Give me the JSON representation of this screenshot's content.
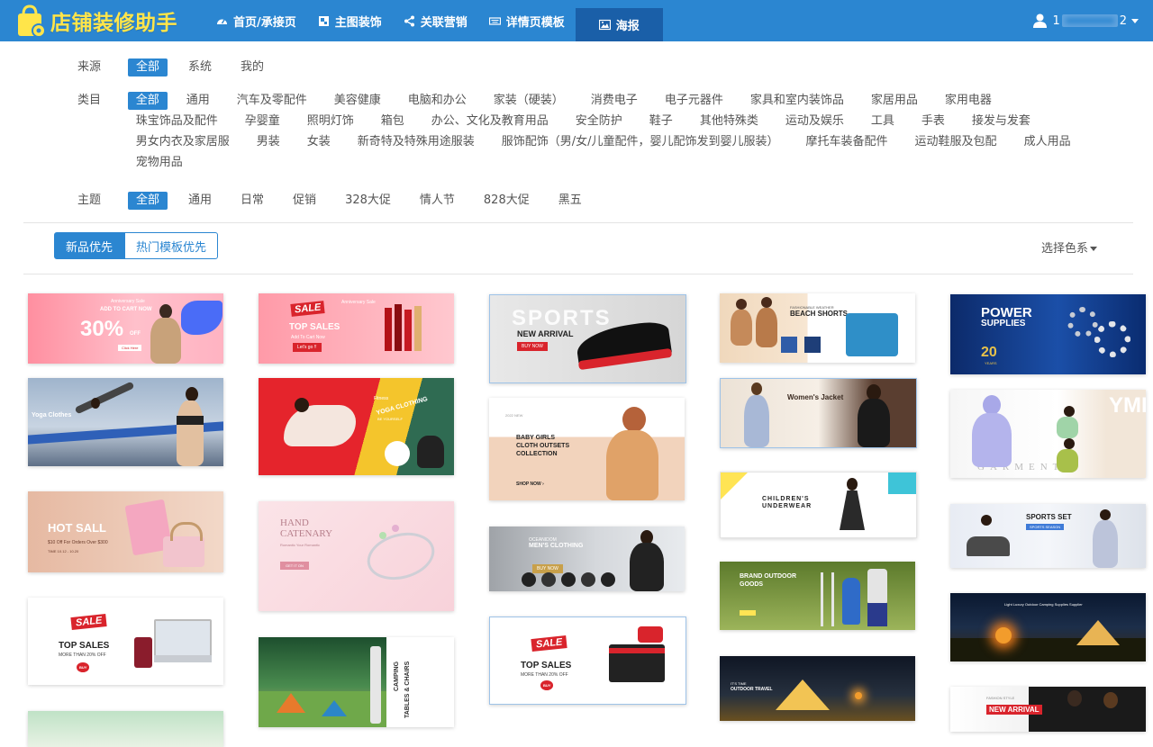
{
  "app": {
    "title": "店铺装修助手"
  },
  "nav": {
    "items": [
      {
        "label": "首页/承接页",
        "icon": "dashboard-icon"
      },
      {
        "label": "主图装饰",
        "icon": "image-frame-icon"
      },
      {
        "label": "关联营销",
        "icon": "share-icon"
      },
      {
        "label": "详情页模板",
        "icon": "keyboard-icon"
      },
      {
        "label": "海报",
        "icon": "picture-icon",
        "active": true
      }
    ],
    "user_prefix": "1",
    "user_suffix": "2"
  },
  "filters": {
    "source": {
      "label": "来源",
      "options": [
        "全部",
        "系统",
        "我的"
      ],
      "selected": "全部"
    },
    "category": {
      "label": "类目",
      "options": [
        "全部",
        "通用",
        "汽车及零配件",
        "美容健康",
        "电脑和办公",
        "家装（硬装）",
        "消费电子",
        "电子元器件",
        "家具和室内装饰品",
        "家居用品",
        "家用电器",
        "珠宝饰品及配件",
        "孕婴童",
        "照明灯饰",
        "箱包",
        "办公、文化及教育用品",
        "安全防护",
        "鞋子",
        "其他特殊类",
        "运动及娱乐",
        "工具",
        "手表",
        "接发与发套",
        "男女内衣及家居服",
        "男装",
        "女装",
        "新奇特及特殊用途服装",
        "服饰配饰（男/女/儿童配件，婴儿配饰发到婴儿服装）",
        "摩托车装备配件",
        "运动鞋服及包配",
        "成人用品",
        "宠物用品"
      ],
      "selected": "全部"
    },
    "theme": {
      "label": "主题",
      "options": [
        "全部",
        "通用",
        "日常",
        "促销",
        "328大促",
        "情人节",
        "828大促",
        "黑五"
      ],
      "selected": "全部"
    }
  },
  "sort": {
    "options": [
      "新品优先",
      "热门模板优先"
    ],
    "selected": "新品优先",
    "color_picker": "选择色系"
  },
  "colors": {
    "primary": "#2b86d1",
    "nav_active": "#1a5fa8",
    "logo_text": "#ffe54a",
    "sale_red": "#d9242c"
  },
  "posters": [
    {
      "id": "p1",
      "lines": [
        "Anniversary Sale",
        "ADD TO CART NOW",
        "30%",
        "OFF",
        "Click Here"
      ]
    },
    {
      "id": "p2",
      "lines": [
        "Yoga Clothes"
      ]
    },
    {
      "id": "p3",
      "lines": [
        "HOT SALL",
        "$10 Off For Orders Over $300",
        "TIME 10.12 - 10.20"
      ]
    },
    {
      "id": "p4",
      "lines": [
        "SALE",
        "TOP SALES",
        "MORE THAN 20% OFF",
        "BUY"
      ]
    },
    {
      "id": "p5",
      "lines": [
        "SALE",
        "Anniversary Sale",
        "TOP SALES",
        "Add To Cart Now",
        "Let's go !!"
      ]
    },
    {
      "id": "p6",
      "lines": [
        "Fitness",
        "YOGA CLOTHING",
        "BE YOURSELF"
      ]
    },
    {
      "id": "p7",
      "lines": [
        "HAND",
        "CATENARY",
        "Romantic Your Romantic",
        "GET IT ON"
      ]
    },
    {
      "id": "p8",
      "lines": [
        "CAMPING",
        "TABLES & CHAIRS"
      ]
    },
    {
      "id": "p9",
      "lines": [
        "SPORTS",
        "NEW ARRIVAL",
        "BUY NOW"
      ]
    },
    {
      "id": "p10",
      "lines": [
        "2022 NEW",
        "BABY GIRLS",
        "CLOTH OUTSETS",
        "COLLECTION",
        "SHOP NOW ›"
      ]
    },
    {
      "id": "p11",
      "lines": [
        "OCEANIDOM",
        "MEN'S CLOTHING",
        "BUY NOW"
      ]
    },
    {
      "id": "p12",
      "lines": [
        "SALE",
        "TOP SALES",
        "MORE THAN 20% OFF",
        "BUY"
      ]
    },
    {
      "id": "p13",
      "lines": [
        "FASHIONABLE WEATHER",
        "BEACH SHORTS"
      ]
    },
    {
      "id": "p14",
      "lines": [
        "Women's Jacket"
      ]
    },
    {
      "id": "p15",
      "lines": [
        "CHILDREN'S",
        "UNDERWEAR"
      ]
    },
    {
      "id": "p16",
      "lines": [
        "BRAND OUTDOOR",
        "GOODS"
      ]
    },
    {
      "id": "p17",
      "lines": [
        "IT'S TIME",
        "OUTDOOR TRAVEL"
      ]
    },
    {
      "id": "p18",
      "lines": [
        "POWER",
        "SUPPLIES",
        "20",
        "YEARS"
      ]
    },
    {
      "id": "p19",
      "lines": [
        "YML",
        "GARMENT"
      ]
    },
    {
      "id": "p20",
      "lines": [
        "SPORTS SET",
        "SPORTS SEASON"
      ]
    },
    {
      "id": "p21",
      "lines": [
        "Light Luxury Outdoor Camping Supplies Supplier"
      ]
    },
    {
      "id": "p22",
      "lines": [
        "FASHION STYLE",
        "NEW ARRIVAL"
      ]
    }
  ]
}
